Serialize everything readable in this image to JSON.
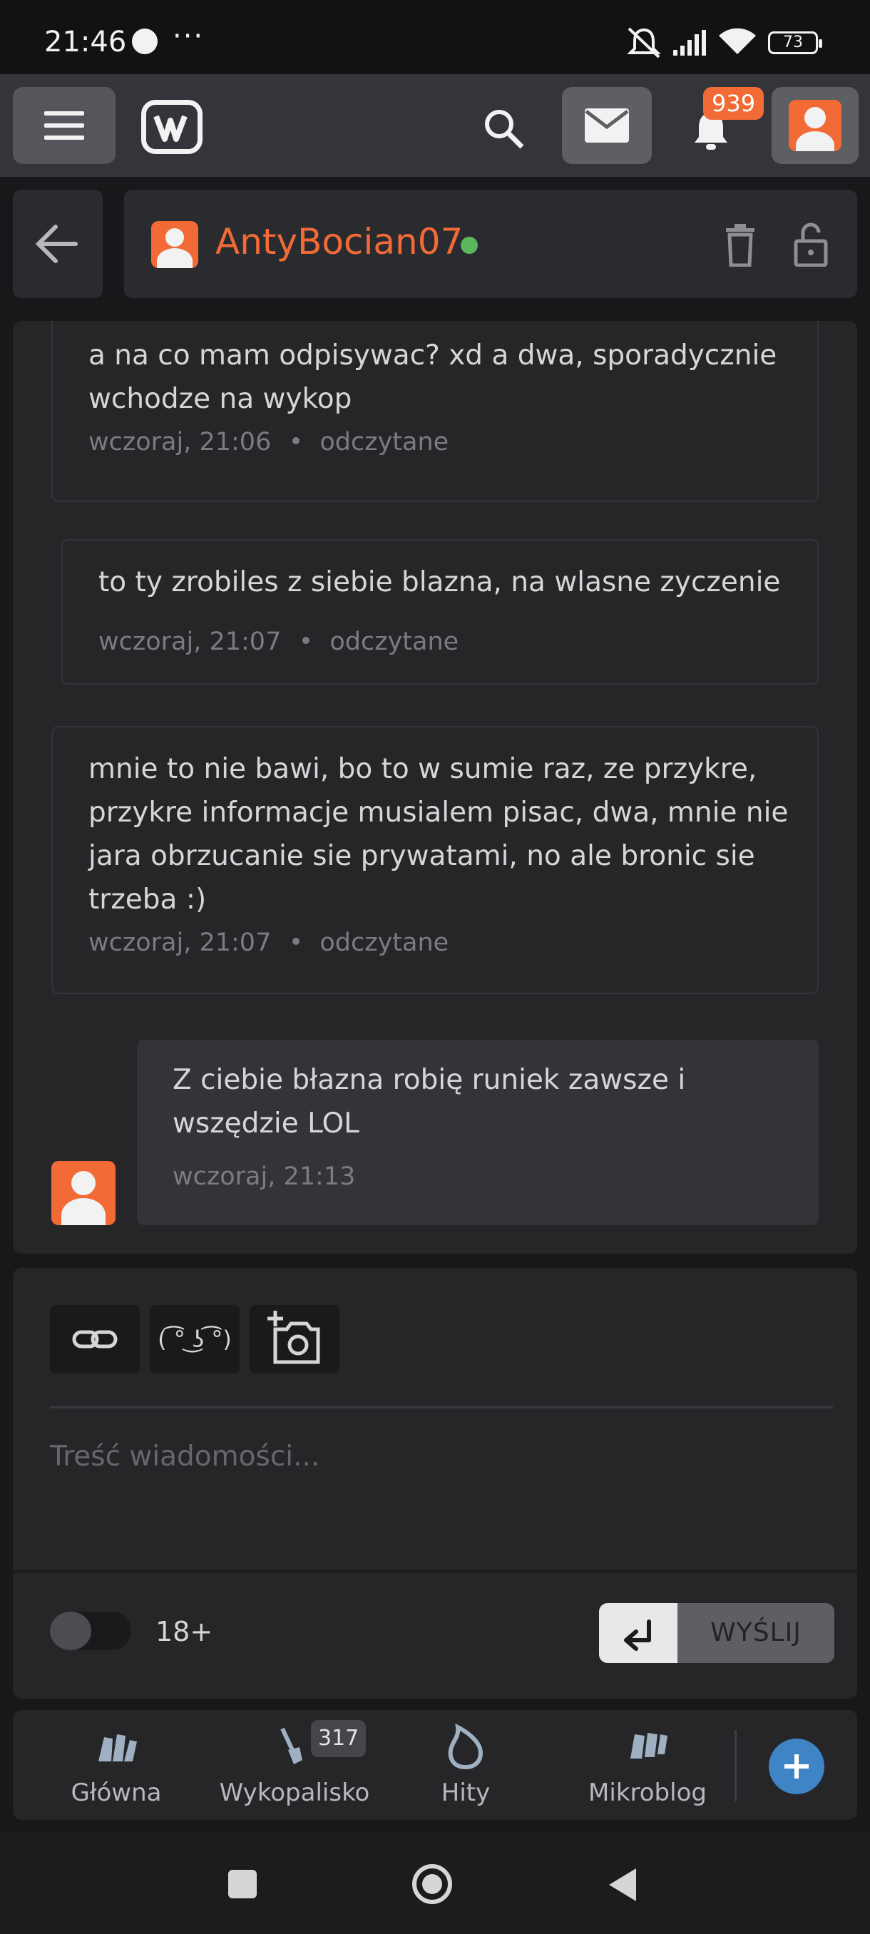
{
  "status_bar": {
    "time": "21:46",
    "dots": "···",
    "battery": "73"
  },
  "app_bar": {
    "notifications_count": "939"
  },
  "conversation": {
    "username": "AntyBocian07",
    "online_color": "#5cb85c",
    "messages": [
      {
        "text": "a na co mam odpisywac? xd a dwa, sporadycznie wchodze na wykop",
        "time": "wczoraj, 21:06",
        "status": "odczytane"
      },
      {
        "text": "to ty zrobiles z siebie blazna, na wlasne zyczenie",
        "time": "wczoraj, 21:07",
        "status": "odczytane"
      },
      {
        "text": "mnie to nie bawi, bo to w sumie raz, ze przykre, przykre informacje musialem pisac, dwa, mnie nie jara obrzucanie sie prywatami, no ale bronic sie trzeba :)",
        "time": "wczoraj, 21:07",
        "status": "odczytane"
      },
      {
        "text": "Z ciebie błazna robię runiek zawsze i wszędzie LOL",
        "time": "wczoraj, 21:13"
      }
    ]
  },
  "compose": {
    "lenny_label": "( ͡° ͜ʖ ͡°)",
    "placeholder": "Treść wiadomości...",
    "adult_label": "18+",
    "send_label": "WYŚLIJ"
  },
  "bottom_nav": {
    "items": [
      {
        "label": "Główna"
      },
      {
        "label": "Wykopalisko",
        "badge": "317"
      },
      {
        "label": "Hity"
      },
      {
        "label": "Mikroblog"
      }
    ]
  },
  "colors": {
    "accent": "#f26a35",
    "fab": "#3f84c4"
  }
}
